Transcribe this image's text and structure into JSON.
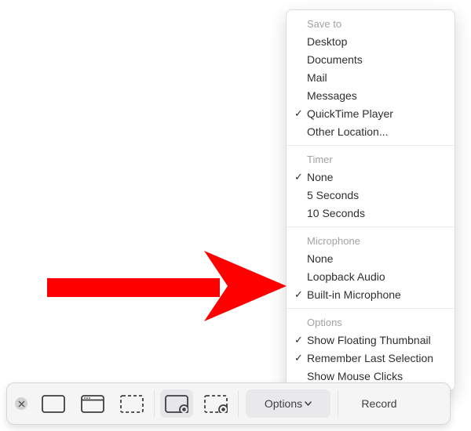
{
  "menu": {
    "saveTo": {
      "header": "Save to",
      "desktop": "Desktop",
      "documents": "Documents",
      "mail": "Mail",
      "messages": "Messages",
      "quicktime": "QuickTime Player",
      "other": "Other Location..."
    },
    "timer": {
      "header": "Timer",
      "none": "None",
      "s5": "5 Seconds",
      "s10": "10 Seconds"
    },
    "microphone": {
      "header": "Microphone",
      "none": "None",
      "loopback": "Loopback Audio",
      "builtin": "Built-in Microphone"
    },
    "options": {
      "header": "Options",
      "thumb": "Show Floating Thumbnail",
      "remember": "Remember Last Selection",
      "mouse": "Show Mouse Clicks"
    },
    "check": "✓"
  },
  "toolbar": {
    "options": "Options",
    "record": "Record"
  }
}
